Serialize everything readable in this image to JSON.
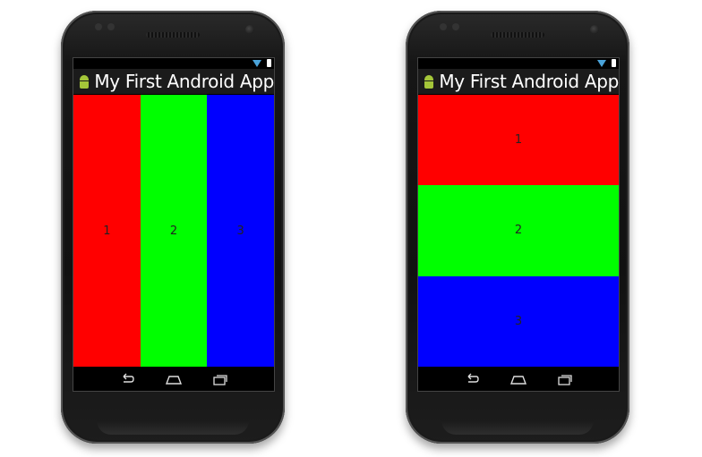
{
  "phones": [
    {
      "app_title": "My First Android App",
      "orientation": "horizontal",
      "panels": [
        {
          "label": "1",
          "color": "#ff0000"
        },
        {
          "label": "2",
          "color": "#00ff00"
        },
        {
          "label": "3",
          "color": "#0000ff"
        }
      ]
    },
    {
      "app_title": "My First Android App",
      "orientation": "vertical",
      "panels": [
        {
          "label": "1",
          "color": "#ff0000"
        },
        {
          "label": "2",
          "color": "#00ff00"
        },
        {
          "label": "3",
          "color": "#0000ff"
        }
      ]
    }
  ],
  "icons": {
    "app": "android-icon",
    "back": "back-icon",
    "home": "home-icon",
    "recents": "recents-icon",
    "wifi": "wifi-icon",
    "battery": "battery-icon"
  }
}
